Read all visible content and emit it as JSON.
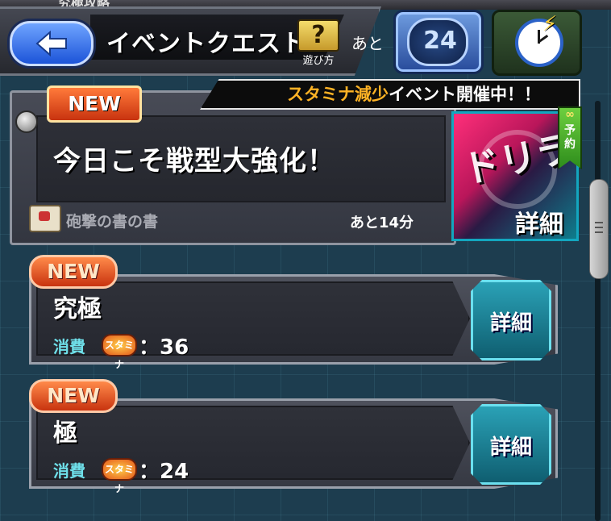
{
  "header": {
    "top_clipped_text": "究極攻略",
    "title": "イベントクエスト",
    "howto_label": "遊び方",
    "remain_prefix": "あと",
    "counter_value": "24"
  },
  "event": {
    "banner_highlight": "スタミナ減少",
    "banner_rest": "イベント開催中！！",
    "new_label": "NEW",
    "title": "今日こそ戦型大強化！",
    "subtitle": "砲撃の書の書",
    "remaining": "あと14分",
    "thumb_art": "ドリラ",
    "detail_label": "詳細",
    "reserve_symbol": "∞",
    "reserve_text": "予約"
  },
  "quests": [
    {
      "new_label": "NEW",
      "name": "究極",
      "consume_label": "消費",
      "stamina_icon": "スタミナ",
      "value": "：36",
      "detail_label": "詳細"
    },
    {
      "new_label": "NEW",
      "name": "極",
      "consume_label": "消費",
      "stamina_icon": "スタミナ",
      "value": "：24",
      "detail_label": "詳細"
    }
  ],
  "colors": {
    "accent_cyan": "#6be0ef",
    "new_orange": "#e4571b",
    "highlight": "#ffb325"
  }
}
